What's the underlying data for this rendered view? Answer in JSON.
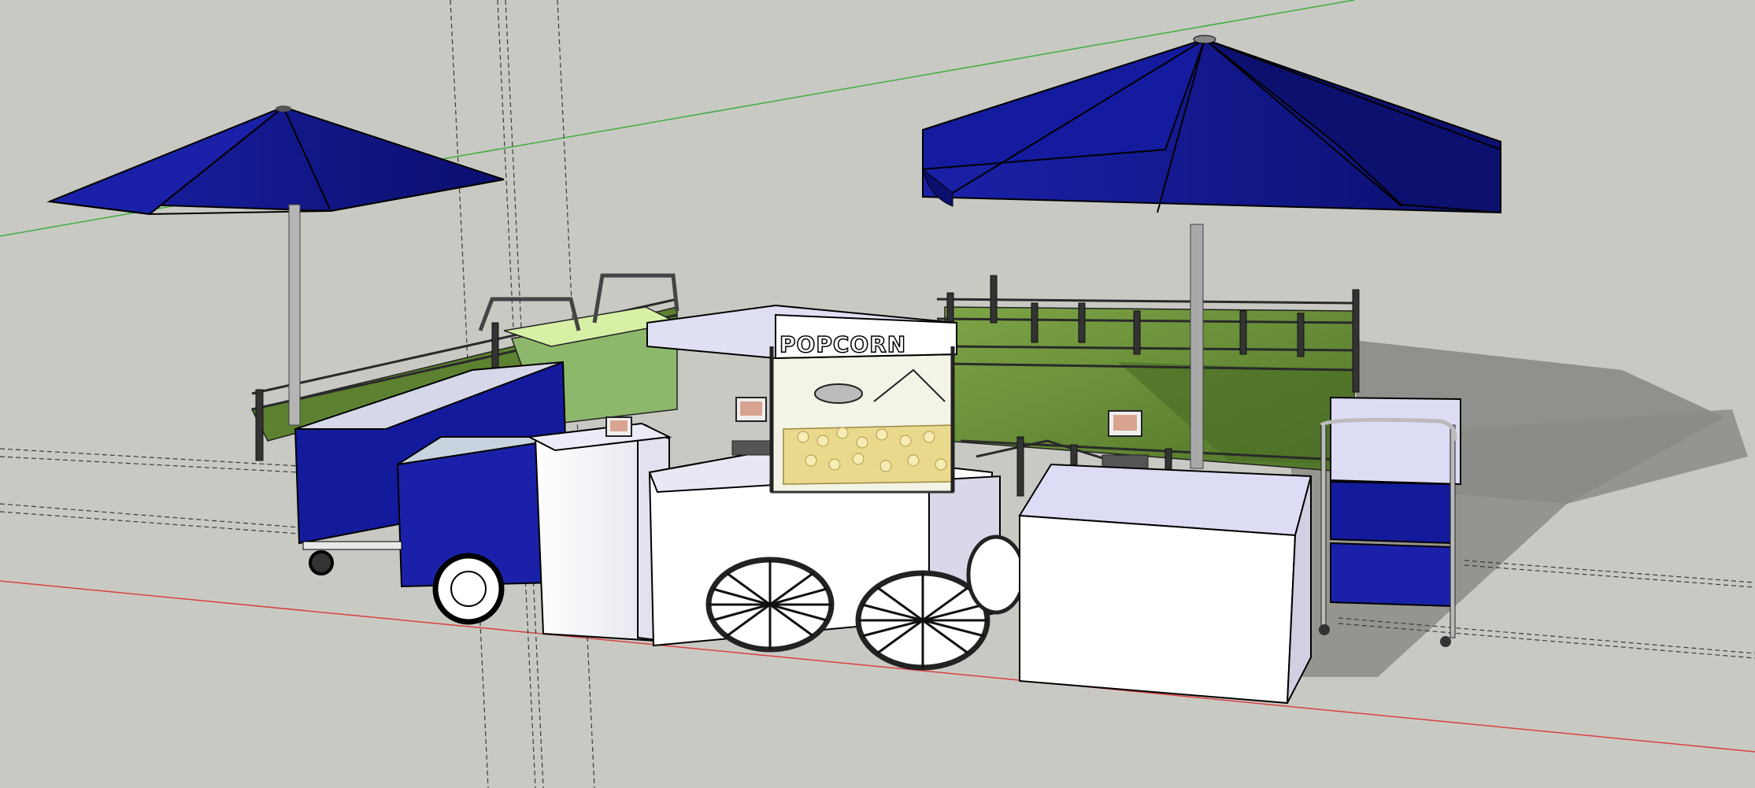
{
  "app": {
    "kind": "3d-modeling-viewport"
  },
  "scene": {
    "background_color": "#c9c9c4",
    "sign_text": "POPCORN",
    "colors": {
      "umbrella": "#12179a",
      "umbrella_dark": "#0b0f6e",
      "cart_blue": "#131a9c",
      "platform_grass": "#6a8f3a",
      "grass_light": "#8fb356",
      "railing": "#2a2a2a",
      "cabinet_white": "#ffffff",
      "cabinet_top": "#dcdcf4",
      "axis_red": "#d94040",
      "axis_green": "#3fae3f",
      "shadow": "#8f8f8b",
      "popcorn": "#e9d98c"
    }
  }
}
